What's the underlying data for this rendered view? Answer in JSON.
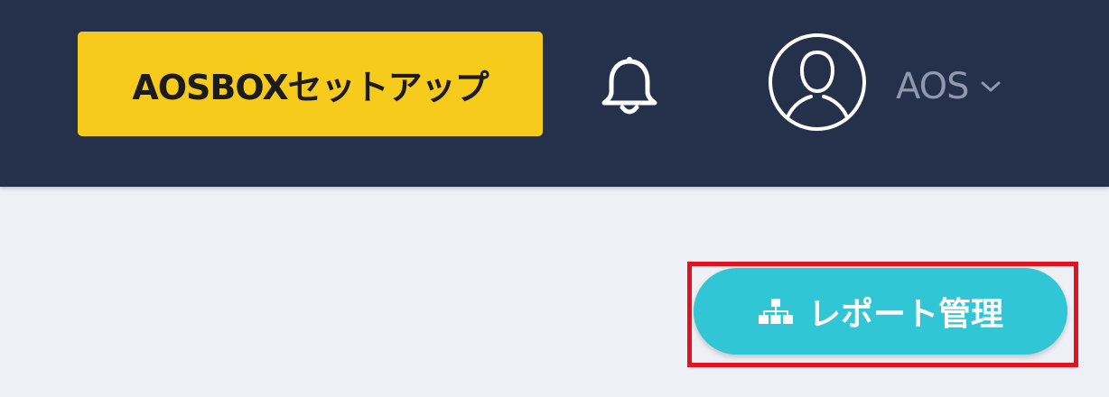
{
  "header": {
    "setup_button_label": "AOSBOXセットアップ",
    "bell_icon": "bell-icon",
    "avatar_icon": "user-avatar-icon",
    "user_name": "AOS",
    "user_menu_icon": "chevron-down-icon"
  },
  "main": {
    "report_button_label": "レポート管理",
    "report_button_icon": "sitemap-icon"
  },
  "colors": {
    "header_bg": "#25314b",
    "page_bg": "#eef0f5",
    "setup_button": "#f7cb1b",
    "report_button": "#30c6d5",
    "highlight_border": "#e0141c"
  }
}
